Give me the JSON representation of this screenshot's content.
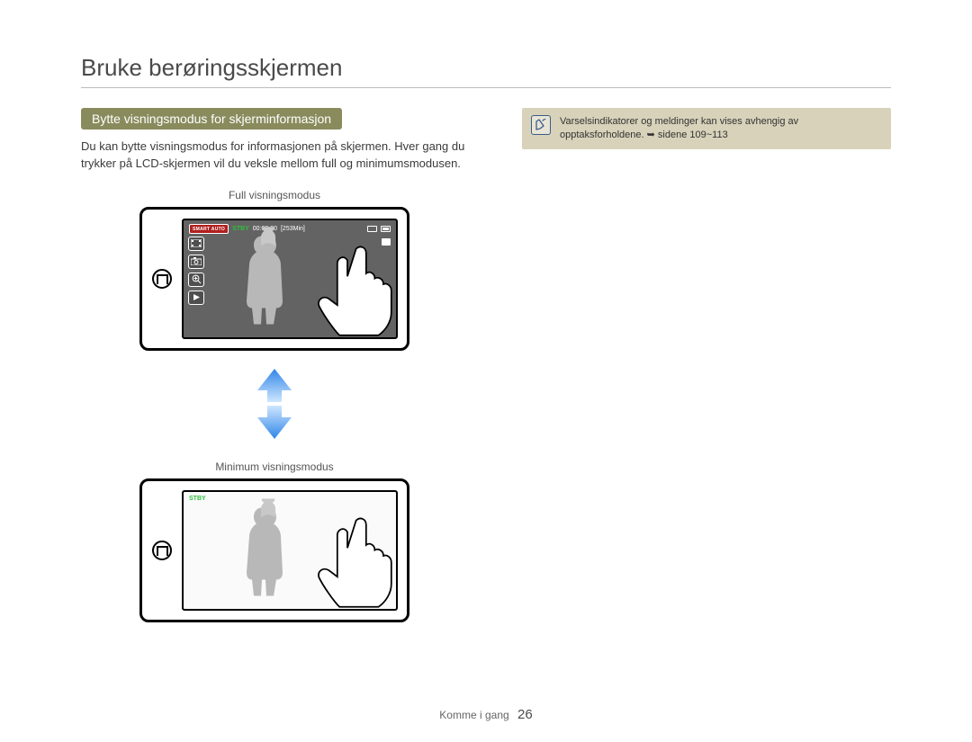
{
  "title": "Bruke berøringsskjermen",
  "section_tag": "Bytte visningsmodus for skjerminformasjon",
  "body": "Du kan bytte visningsmodus for informasjonen på skjermen. Hver gang du trykker på LCD-skjermen vil du veksle mellom full og minimumsmodusen.",
  "caption_full": "Full visningsmodus",
  "caption_min": "Minimum visningsmodus",
  "osd": {
    "smart": "SMART\nAUTO",
    "stby": "STBY",
    "time": "00:00:00",
    "remain": "[253Min]"
  },
  "note": {
    "text": "Varselsindikatorer og meldinger kan vises avhengig av opptaksforholdene. ",
    "arrow": "➥",
    "page_ref": "sidene 109~113"
  },
  "footer": {
    "section": "Komme i gang",
    "page": "26"
  }
}
